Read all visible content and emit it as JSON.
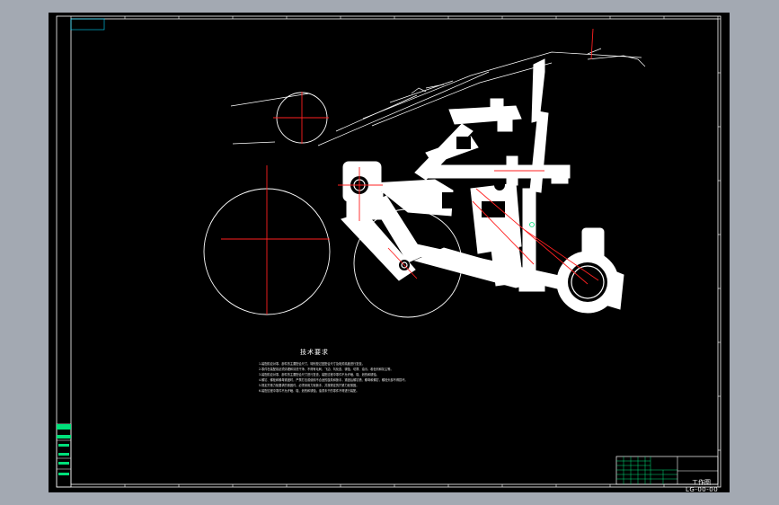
{
  "notes": {
    "title": "技术要求",
    "lines": [
      "1.装配前应对零、部件的主要配合尺寸，特别是过盈配合尺寸及相关精度进行复查。",
      "2.零件在装配前必须清理和清洗干净，不得有毛刺、飞边、氧化皮、锈蚀、切屑、油污、着色剂和灰尘等。",
      "3.装配前应对零、部件的主要配合尺寸进行复查，装配过程中零件不允许磕、碰、划伤和锈蚀。",
      "4.螺钉、螺栓和螺母紧固时，严禁打击或使用不合适的旋具和扳手，紧固后螺钉槽、螺母和螺钉、螺栓头部不得损坏。",
      "5.规定拧紧力矩要求的紧固件，必须采用力矩扳手，并按规定的拧紧力矩紧固。",
      "6.装配过程中零件不允许磕、碰、划伤和锈蚀，油漆未干的零件不得进行装配。"
    ]
  },
  "title_block": {
    "title": "工作图",
    "code": "LG-00-00"
  },
  "colors": {
    "background": "#000000",
    "frame": "#ffffff",
    "centerline": "#ff2020",
    "accent": "#00e07a",
    "cyan": "#00d8ff"
  }
}
